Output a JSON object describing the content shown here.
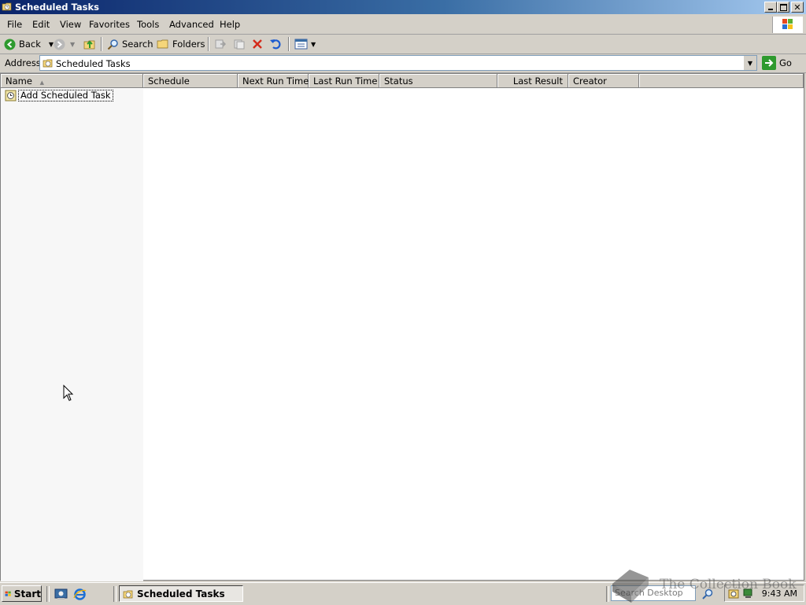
{
  "window": {
    "title": "Scheduled Tasks"
  },
  "menu": {
    "items": [
      "File",
      "Edit",
      "View",
      "Favorites",
      "Tools",
      "Advanced",
      "Help"
    ]
  },
  "toolbar": {
    "back_label": "Back",
    "search_label": "Search",
    "folders_label": "Folders"
  },
  "address": {
    "label": "Address",
    "value": "Scheduled Tasks",
    "go_label": "Go"
  },
  "listview": {
    "columns": [
      "Name",
      "Schedule",
      "Next Run Time",
      "Last Run Time",
      "Status",
      "Last Result",
      "Creator"
    ],
    "items": [
      {
        "name": "Add Scheduled Task"
      }
    ]
  },
  "taskbar": {
    "start_label": "Start",
    "task_label": "Scheduled Tasks",
    "search_placeholder": "Search Desktop",
    "clock": "9:43 AM"
  },
  "watermark": "The Collection Book",
  "colors": {
    "title_gradient_start": "#0a246a",
    "title_gradient_end": "#a6caf0",
    "face": "#d4d0c8"
  }
}
